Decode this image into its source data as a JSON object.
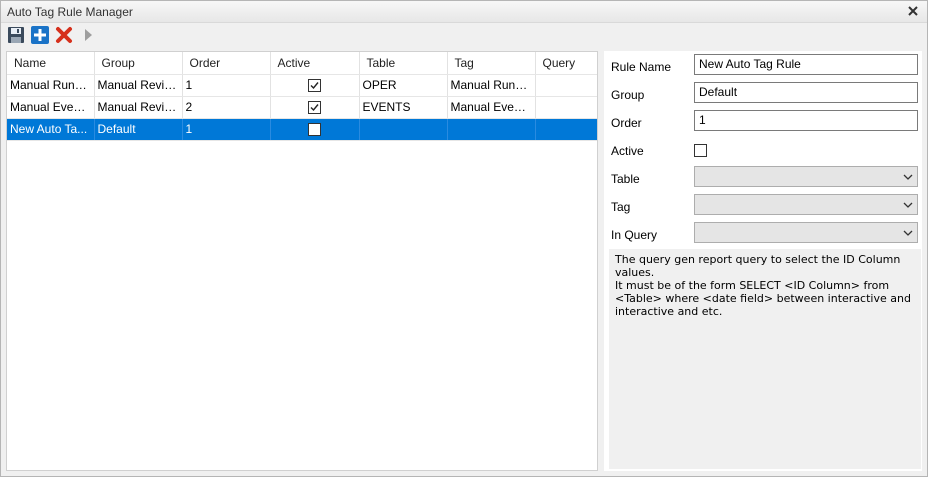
{
  "window": {
    "title": "Auto Tag Rule Manager"
  },
  "toolbar": {
    "save_icon": "floppy-disk-icon",
    "add_icon": "plus-icon",
    "delete_icon": "red-x-icon",
    "run_icon": "play-arrow-icon"
  },
  "grid": {
    "columns": [
      "Name",
      "Group",
      "Order",
      "Active",
      "Table",
      "Tag",
      "Query"
    ],
    "rows": [
      {
        "name": "Manual Runw...",
        "group": "Manual Revie...",
        "order": "1",
        "active": true,
        "table": "OPER",
        "tag": "Manual Runw...",
        "query": ""
      },
      {
        "name": "Manual Event...",
        "group": "Manual Revie...",
        "order": "2",
        "active": true,
        "table": "EVENTS",
        "tag": "Manual Event ...",
        "query": ""
      },
      {
        "name": "New Auto Ta...",
        "group": "Default",
        "order": "1",
        "active": false,
        "table": "",
        "tag": "",
        "query": "",
        "selected": true
      }
    ]
  },
  "form": {
    "rule_name_label": "Rule Name",
    "rule_name_value": "New Auto Tag Rule",
    "group_label": "Group",
    "group_value": "Default",
    "order_label": "Order",
    "order_value": "1",
    "active_label": "Active",
    "active_value": false,
    "table_label": "Table",
    "table_value": "",
    "tag_label": "Tag",
    "tag_value": "",
    "in_query_label": "In Query",
    "in_query_value": ""
  },
  "description": {
    "line1": "The query gen report query to select the ID Column values.",
    "line2": "It must be of the form SELECT <ID Column> from <Table> where <date field> between interactive and interactive and etc."
  },
  "colors": {
    "selection": "#0078d7",
    "delete_red": "#d6301c",
    "add_blue": "#1a73c7"
  }
}
